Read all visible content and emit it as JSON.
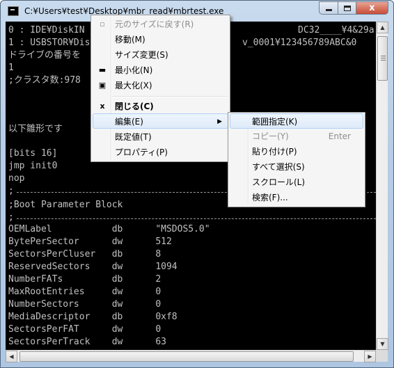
{
  "window": {
    "title": "C:¥Users¥test¥Desktop¥mbr_read¥mbrtest.exe",
    "controls": {
      "minimize": "",
      "maximize": "",
      "close": "x"
    }
  },
  "console": {
    "lines": [
      "0 : IDE¥DiskIN",
      "1 : USBSTOR¥Dis",
      "ドライブの番号を",
      "1",
      ";クラスタ数:978",
      "以下雛形です",
      "[bits 16]",
      "jmp init0",
      "nop",
      ";",
      ";Boot Parameter Block",
      ";",
      "OEMLabel           db      \"MSDOS5.0\"",
      "BytePerSector      dw      512",
      "SectorsPerCluser   db      8",
      "ReservedSectors    dw      1094",
      "NumberFATs         db      2",
      "MaxRootEntries     dw      0",
      "NumberSectors      dw      0",
      "MediaDescriptor    db      0xf8",
      "SectorsPerFAT      dw      0",
      "SectorsPerTrack    dw      63"
    ],
    "right_fragments": [
      "DC32____¥4&29a",
      "v_0001¥123456789ABC&0"
    ]
  },
  "system_menu": {
    "items": [
      {
        "label": "元のサイズに戻す(R)",
        "icon": "restore-icon",
        "glyph": "▫",
        "disabled": true
      },
      {
        "label": "移動(M)",
        "disabled": false
      },
      {
        "label": "サイズ変更(S)",
        "disabled": false
      },
      {
        "label": "最小化(N)",
        "icon": "minimize-icon",
        "glyph": "▬",
        "disabled": false
      },
      {
        "label": "最大化(X)",
        "icon": "maximize-icon",
        "glyph": "▣",
        "disabled": false
      },
      {
        "label": "閉じる(C)",
        "icon": "close-icon",
        "glyph": "x",
        "bold": true,
        "disabled": false
      },
      {
        "label": "編集(E)",
        "submenu": true,
        "highlighted": true
      },
      {
        "label": "既定値(T)",
        "disabled": false
      },
      {
        "label": "プロパティ(P)",
        "disabled": false
      }
    ]
  },
  "edit_submenu": {
    "items": [
      {
        "label": "範囲指定(K)",
        "highlighted": true
      },
      {
        "label": "コピー(Y)",
        "accelerator": "Enter",
        "disabled": true
      },
      {
        "label": "貼り付け(P)"
      },
      {
        "label": "すべて選択(S)"
      },
      {
        "label": "スクロール(L)"
      },
      {
        "label": "検索(F)..."
      }
    ]
  },
  "colors": {
    "console_bg": "#000000",
    "console_fg": "#c0c0c0",
    "highlight_border": "#aecff7",
    "close_button": "#c74c36"
  }
}
